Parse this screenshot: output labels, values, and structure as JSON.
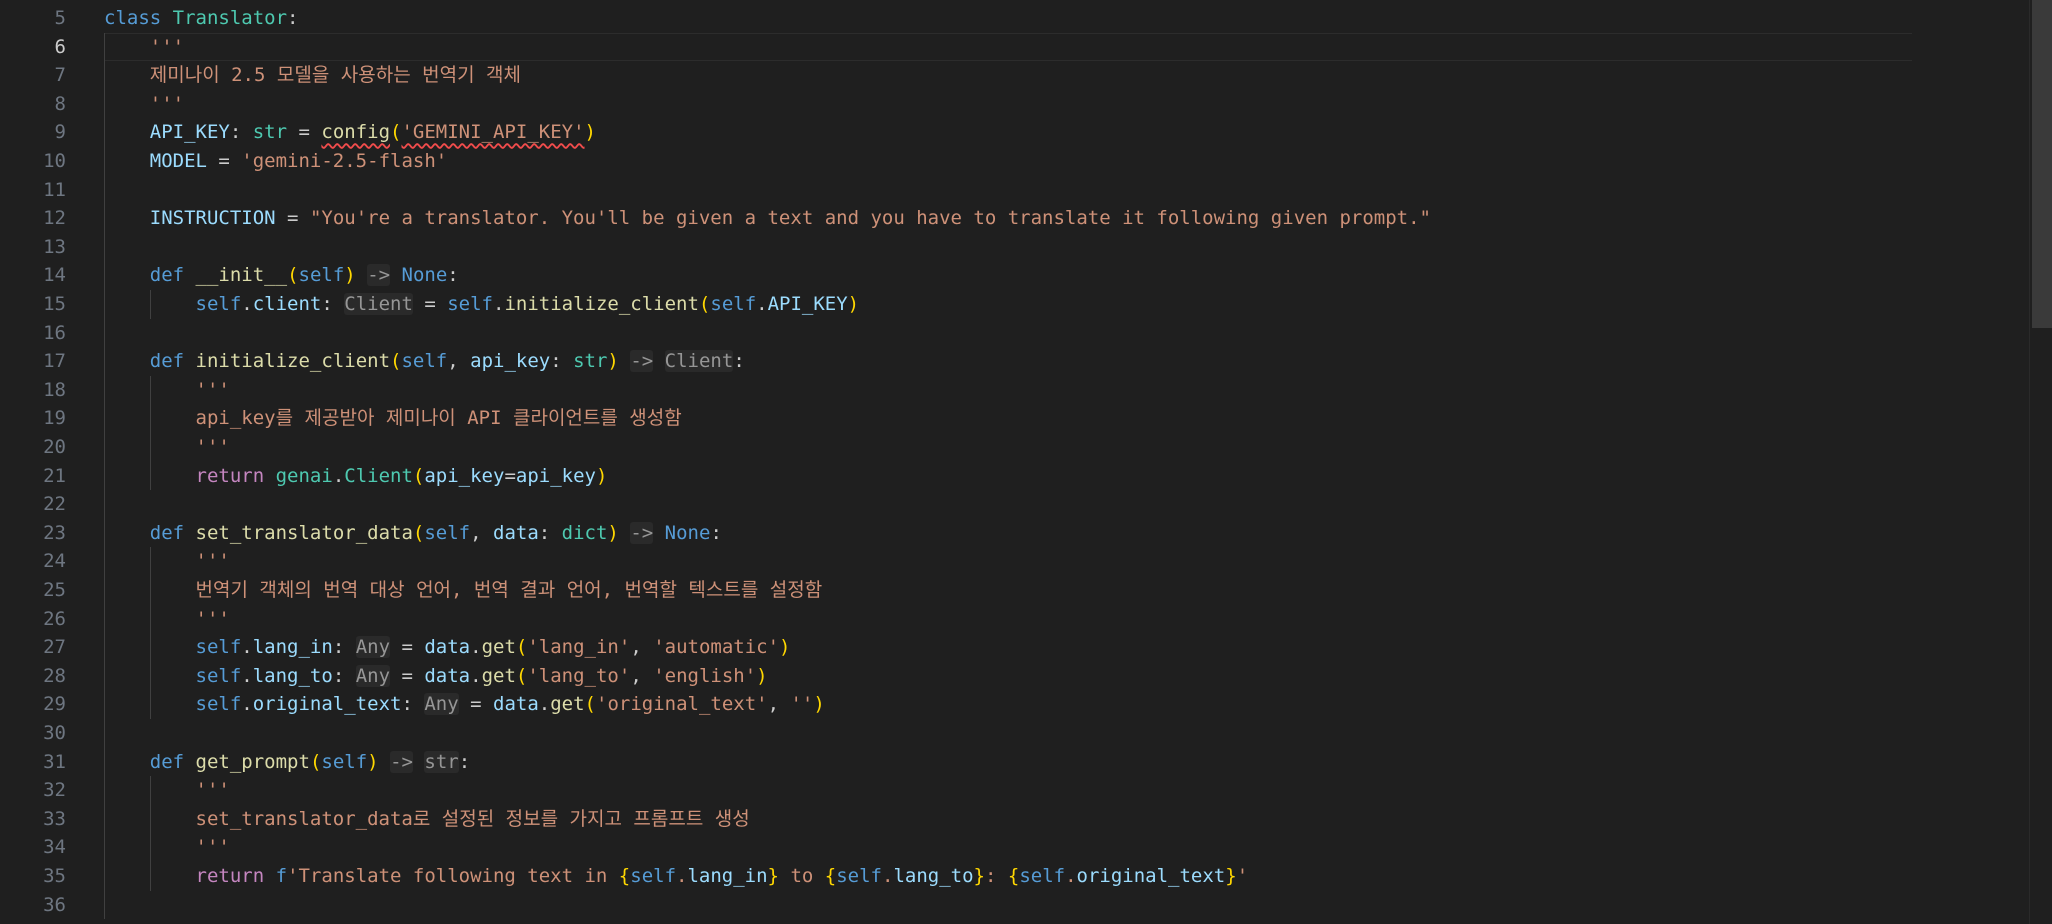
{
  "editor": {
    "active_line": "6",
    "lines": [
      {
        "no": "5",
        "text": "class Translator:"
      },
      {
        "no": "6",
        "text": "    '''"
      },
      {
        "no": "7",
        "text": "    제미나이 2.5 모델을 사용하는 번역기 객체"
      },
      {
        "no": "8",
        "text": "    '''"
      },
      {
        "no": "9",
        "text": "    API_KEY: str = config('GEMINI_API_KEY')"
      },
      {
        "no": "10",
        "text": "    MODEL = 'gemini-2.5-flash'"
      },
      {
        "no": "11",
        "text": ""
      },
      {
        "no": "12",
        "text": "    INSTRUCTION = \"You're a translator. You'll be given a text and you have to translate it following given prompt.\""
      },
      {
        "no": "13",
        "text": ""
      },
      {
        "no": "14",
        "text": "    def __init__(self) -> None:"
      },
      {
        "no": "15",
        "text": "        self.client: Client = self.initialize_client(self.API_KEY)"
      },
      {
        "no": "16",
        "text": ""
      },
      {
        "no": "17",
        "text": "    def initialize_client(self, api_key: str) -> Client:"
      },
      {
        "no": "18",
        "text": "        '''"
      },
      {
        "no": "19",
        "text": "        api_key를 제공받아 제미나이 API 클라이언트를 생성함"
      },
      {
        "no": "20",
        "text": "        '''"
      },
      {
        "no": "21",
        "text": "        return genai.Client(api_key=api_key)"
      },
      {
        "no": "22",
        "text": ""
      },
      {
        "no": "23",
        "text": "    def set_translator_data(self, data: dict) -> None:"
      },
      {
        "no": "24",
        "text": "        '''"
      },
      {
        "no": "25",
        "text": "        번역기 객체의 번역 대상 언어, 번역 결과 언어, 번역할 텍스트를 설정함"
      },
      {
        "no": "26",
        "text": "        '''"
      },
      {
        "no": "27",
        "text": "        self.lang_in: Any = data.get('lang_in', 'automatic')"
      },
      {
        "no": "28",
        "text": "        self.lang_to: Any = data.get('lang_to', 'english')"
      },
      {
        "no": "29",
        "text": "        self.original_text: Any = data.get('original_text', '')"
      },
      {
        "no": "30",
        "text": ""
      },
      {
        "no": "31",
        "text": "    def get_prompt(self) -> str:"
      },
      {
        "no": "32",
        "text": "        '''"
      },
      {
        "no": "33",
        "text": "        set_translator_data로 설정된 정보를 가지고 프롬프트 생성"
      },
      {
        "no": "34",
        "text": "        '''"
      },
      {
        "no": "35",
        "text": "        return f'Translate following text in {self.lang_in} to {self.lang_to}: {self.original_text}'"
      },
      {
        "no": "36",
        "text": ""
      }
    ]
  },
  "colors": {
    "background": "#1f1f1f",
    "keyword": "#569cd6",
    "control": "#c586c0",
    "class": "#4ec9b0",
    "function": "#dcdcaa",
    "string": "#ce9178",
    "variable": "#9cdcfe",
    "line_number": "#6e7681",
    "error_squiggle": "#f14c4c"
  }
}
